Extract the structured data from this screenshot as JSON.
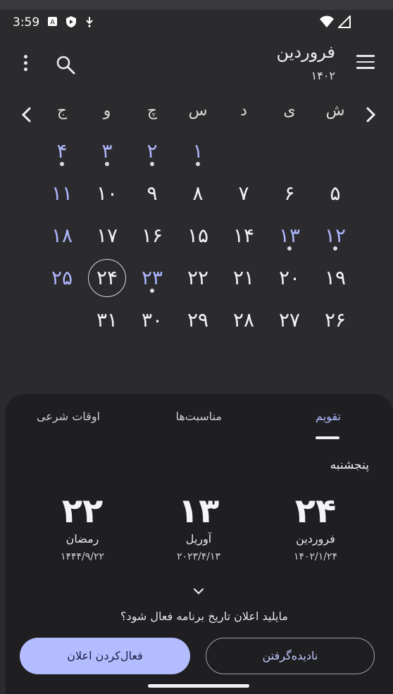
{
  "status": {
    "time": "3:59",
    "left_icons": [
      "notification-a-icon",
      "shield-play-icon",
      "download-icon"
    ],
    "right_icons": [
      "wifi-icon",
      "cell-signal-icon"
    ]
  },
  "header": {
    "month": "فروردین",
    "year": "۱۴۰۲",
    "icons": [
      "menu-icon",
      "search-icon",
      "more-vert-icon"
    ]
  },
  "weekdays": [
    "ش",
    "ی",
    "د",
    "س",
    "چ",
    "و",
    "ج"
  ],
  "calendar": {
    "rows": [
      [
        {
          "t": ""
        },
        {
          "t": ""
        },
        {
          "t": ""
        },
        {
          "t": "۱",
          "h": true,
          "e": true
        },
        {
          "t": "۲",
          "h": true,
          "e": true
        },
        {
          "t": "۳",
          "h": true,
          "e": true
        },
        {
          "t": "۴",
          "h": true,
          "e": true
        }
      ],
      [
        {
          "t": "۵"
        },
        {
          "t": "۶"
        },
        {
          "t": "۷"
        },
        {
          "t": "۸"
        },
        {
          "t": "۹"
        },
        {
          "t": "۱۰"
        },
        {
          "t": "۱۱",
          "h": true
        }
      ],
      [
        {
          "t": "۱۲",
          "h": true,
          "e": true
        },
        {
          "t": "۱۳",
          "h": true,
          "e": true
        },
        {
          "t": "۱۴"
        },
        {
          "t": "۱۵"
        },
        {
          "t": "۱۶"
        },
        {
          "t": "۱۷"
        },
        {
          "t": "۱۸",
          "h": true
        }
      ],
      [
        {
          "t": "۱۹"
        },
        {
          "t": "۲۰"
        },
        {
          "t": "۲۱"
        },
        {
          "t": "۲۲"
        },
        {
          "t": "۲۳",
          "h": true,
          "e": true
        },
        {
          "t": "۲۴",
          "today": true
        },
        {
          "t": "۲۵",
          "h": true
        }
      ],
      [
        {
          "t": "۲۶"
        },
        {
          "t": "۲۷"
        },
        {
          "t": "۲۸"
        },
        {
          "t": "۲۹"
        },
        {
          "t": "۳۰"
        },
        {
          "t": "۳۱"
        },
        {
          "t": ""
        }
      ]
    ]
  },
  "sheet": {
    "tabs": [
      {
        "label": "تقویم",
        "active": true
      },
      {
        "label": "مناسبت‌ها",
        "active": false
      },
      {
        "label": "اوقات شرعی",
        "active": false
      }
    ],
    "weekday": "پنجشنبه",
    "dates": [
      {
        "big": "۲۴",
        "month": "فروردین",
        "full": "۱۴۰۲/۱/۲۴"
      },
      {
        "big": "۱۳",
        "month": "آوریل",
        "full": "۲۰۲۳/۴/۱۳"
      },
      {
        "big": "۲۲",
        "month": "رمضان",
        "full": "۱۴۴۴/۹/۲۲"
      }
    ],
    "question": "مایلید اعلان تاریخ برنامه فعال شود؟",
    "enable_button": "فعال‌کردن اعلان",
    "dismiss_button": "نادیده‌گرفتن"
  },
  "colors": {
    "background": "#2b2b2d",
    "sheet": "#1f1f21",
    "accent": "#b3bcff",
    "holiday": "#aeb6ff"
  }
}
